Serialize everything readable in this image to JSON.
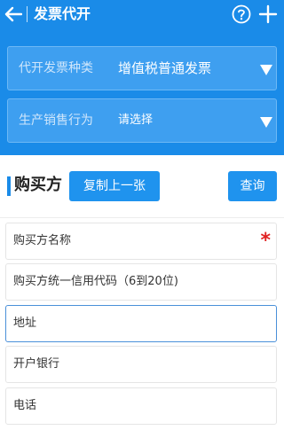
{
  "topbar": {
    "title": "发票代开"
  },
  "selects": [
    {
      "label": "代开发票种类",
      "value": "增值税普通发票"
    },
    {
      "label": "生产销售行为",
      "value": "请选择"
    }
  ],
  "buyer": {
    "section_title": "购买方",
    "copy_button": "复制上一张",
    "query_button": "查询"
  },
  "fields": [
    {
      "placeholder": "购买方名称",
      "required_mark": "*"
    },
    {
      "placeholder": "购买方统一信用代码（6到20位)"
    },
    {
      "placeholder": "地址"
    },
    {
      "placeholder": "开户银行"
    },
    {
      "placeholder": "电话"
    }
  ],
  "colors": {
    "primary": "#1a8be8",
    "required": "#e02020"
  }
}
